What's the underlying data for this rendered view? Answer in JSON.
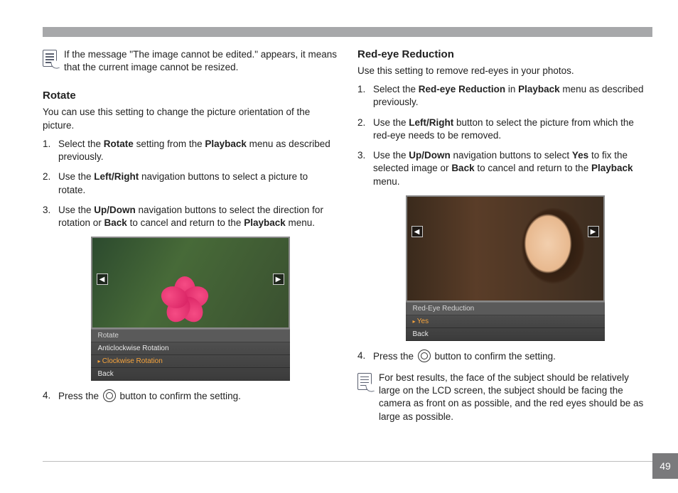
{
  "page_number": "49",
  "left": {
    "note": "If the message \"The image cannot be edited.\" appears, it means that the current image cannot be resized.",
    "heading": "Rotate",
    "intro": "You can use this setting to change the picture orientation of the picture.",
    "steps": [
      {
        "n": "1.",
        "pre": "Select the ",
        "b1": "Rotate",
        "mid": " setting from the ",
        "b2": "Playback",
        "post": " menu as described previously."
      },
      {
        "n": "2.",
        "pre": "Use the ",
        "b1": "Left/Right",
        "mid": " navigation buttons to select a picture to rotate.",
        "b2": "",
        "post": ""
      },
      {
        "n": "3.",
        "pre": "Use the ",
        "b1": "Up/Down",
        "mid": " navigation buttons to select the direction for rotation or ",
        "b2": "Back",
        "post": " to cancel and return to the ",
        "b3": "Playback",
        "tail": " menu."
      },
      {
        "n": "4.",
        "pre": "Press the ",
        "post": " button to confirm the setting."
      }
    ],
    "menu": {
      "header": "Rotate",
      "item1": "Anticlockwise Rotation",
      "item2": "Clockwise Rotation",
      "item3": "Back"
    },
    "arrows": {
      "left": "◀",
      "right": "▶"
    }
  },
  "right": {
    "heading": "Red-eye Reduction",
    "intro": "Use this setting to remove red-eyes in your photos.",
    "steps": [
      {
        "n": "1.",
        "pre": "Select the ",
        "b1": "Red-eye Reduction",
        "mid": " in ",
        "b2": "Playback",
        "post": " menu as described previously."
      },
      {
        "n": "2.",
        "pre": "Use the ",
        "b1": "Left/Right",
        "mid": " button to select the picture from which the red-eye needs to be removed.",
        "b2": "",
        "post": ""
      },
      {
        "n": "3.",
        "pre": "Use the ",
        "b1": "Up/Down",
        "mid": " navigation buttons to select ",
        "b2": "Yes",
        "post": " to fix the selected image or ",
        "b3": "Back",
        "tail": " to cancel and return to the ",
        "b4": "Playback",
        "end": " menu."
      },
      {
        "n": "4.",
        "pre": "Press the ",
        "post": " button to confirm the setting."
      }
    ],
    "menu": {
      "header": "Red-Eye Reduction",
      "item1": "Yes",
      "item2": "Back"
    },
    "note": "For best results, the face of the subject should be relatively large on the LCD screen, the subject should be facing the camera as front on as possible, and the red eyes should be as large as possible."
  }
}
